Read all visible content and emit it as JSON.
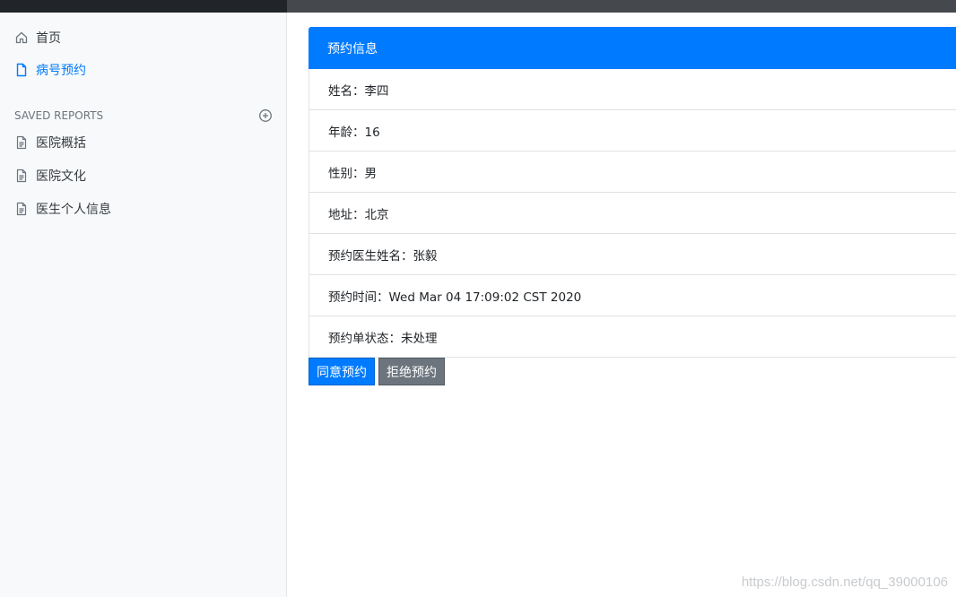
{
  "sidebar": {
    "nav": [
      {
        "label": "首页",
        "icon": "home-icon",
        "active": false
      },
      {
        "label": "病号预约",
        "icon": "file-icon",
        "active": true
      }
    ],
    "section_title": "SAVED REPORTS",
    "reports": [
      {
        "label": "医院概括",
        "icon": "file-text-icon"
      },
      {
        "label": "医院文化",
        "icon": "file-text-icon"
      },
      {
        "label": "医生个人信息",
        "icon": "file-text-icon"
      }
    ]
  },
  "card": {
    "title": "预约信息",
    "rows": [
      "姓名：李四",
      "年龄：16",
      "性别：男",
      "地址：北京",
      "预约医生姓名：张毅",
      "预约时间：Wed Mar 04 17:09:02 CST 2020",
      "预约单状态：未处理"
    ]
  },
  "actions": {
    "accept_label": "同意预约",
    "reject_label": "拒绝预约"
  },
  "watermark": "https://blog.csdn.net/qq_39000106",
  "colors": {
    "accent": "#007bff",
    "secondary": "#6c757d",
    "topbar": "#212529"
  }
}
